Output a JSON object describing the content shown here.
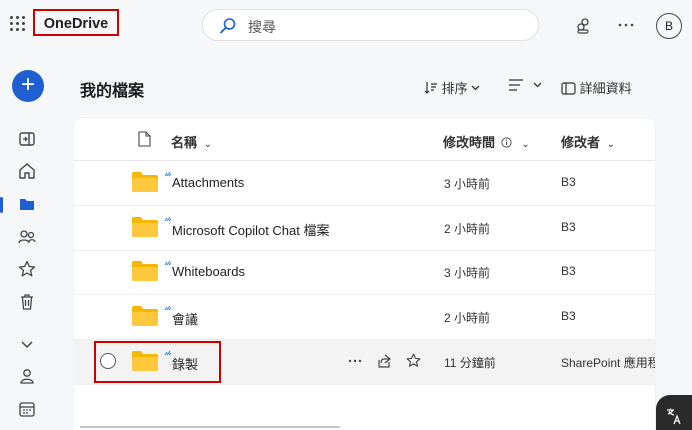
{
  "app": {
    "title": "OneDrive"
  },
  "search": {
    "placeholder": "搜尋"
  },
  "avatar": {
    "initial": "B"
  },
  "page": {
    "title": "我的檔案"
  },
  "commands": {
    "sort": "排序",
    "details": "詳細資料"
  },
  "columns": {
    "name": "名稱",
    "modified": "修改時間",
    "modified_by": "修改者"
  },
  "rows": [
    {
      "name": "Attachments",
      "modified": "3 小時前",
      "modified_by": "B3"
    },
    {
      "name": "Microsoft Copilot Chat 檔案",
      "modified": "2 小時前",
      "modified_by": "B3"
    },
    {
      "name": "Whiteboards",
      "modified": "3 小時前",
      "modified_by": "B3"
    },
    {
      "name": "會議",
      "modified": "2 小時前",
      "modified_by": "B3"
    },
    {
      "name": "錄製",
      "modified": "11 分鐘前",
      "modified_by": "SharePoint 應用程式"
    }
  ],
  "colors": {
    "accent": "#1f5fd1",
    "folder": "#f5b800",
    "highlight": "#d10000"
  },
  "icons": [
    "waffle-icon",
    "search-icon",
    "feedback-icon",
    "more-icon",
    "add-icon",
    "collapse-pane-icon",
    "home-icon",
    "folder-icon",
    "people-icon",
    "star-icon",
    "trash-icon",
    "chevron-down-icon",
    "person-icon",
    "calendar-icon",
    "file-icon",
    "info-icon",
    "share-icon"
  ]
}
